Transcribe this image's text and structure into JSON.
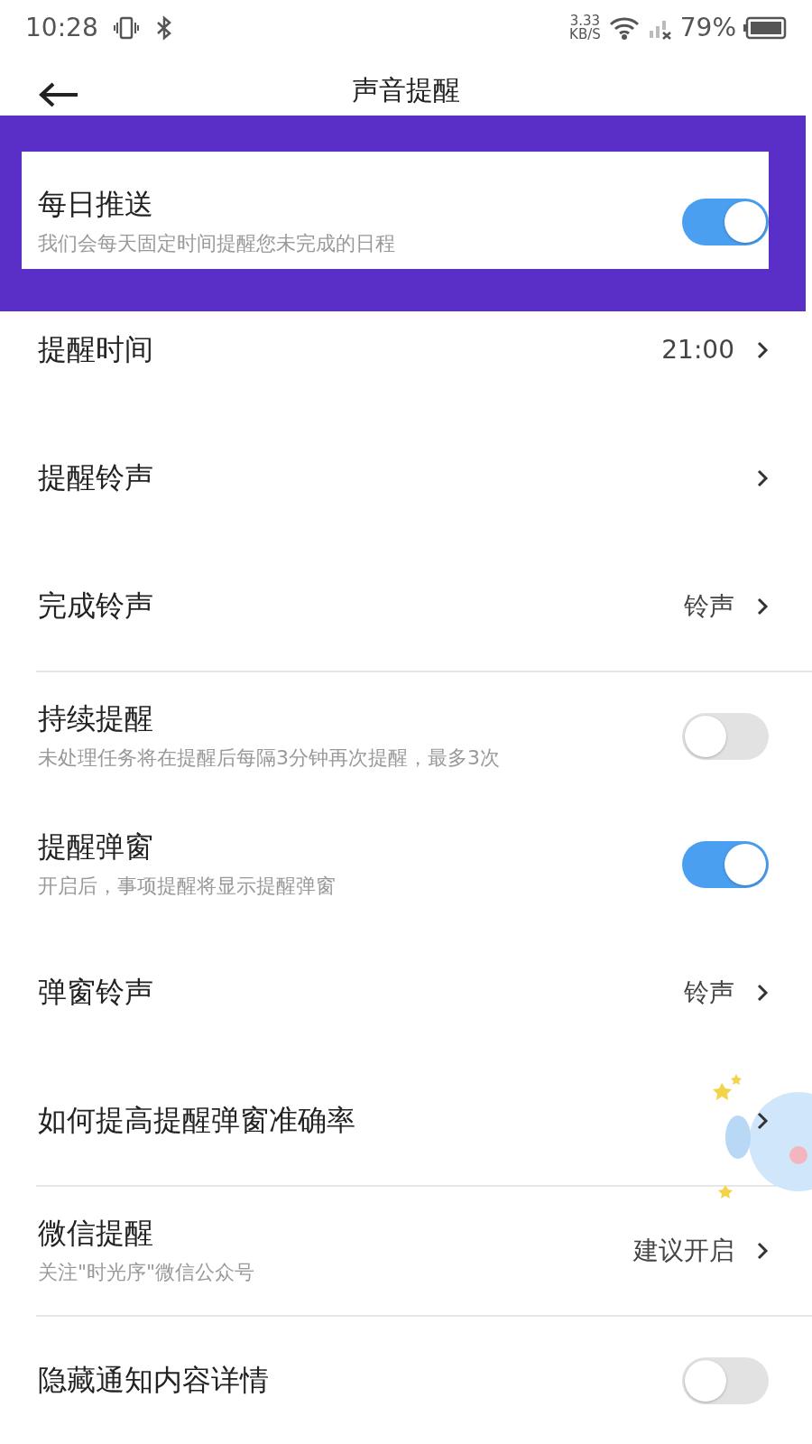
{
  "status_bar": {
    "time": "10:28",
    "speed_value": "3.33",
    "speed_unit": "KB/S",
    "battery": "79%"
  },
  "header": {
    "title": "声音提醒"
  },
  "settings": [
    {
      "kind": "toggle",
      "title": "每日推送",
      "subtitle": "我们会每天固定时间提醒您未完成的日程",
      "on": true,
      "highlighted": true
    },
    {
      "kind": "link",
      "title": "提醒时间",
      "value": "21:00"
    },
    {
      "kind": "link",
      "title": "提醒铃声"
    },
    {
      "kind": "link",
      "title": "完成铃声",
      "value": "铃声",
      "divider_after": true
    },
    {
      "kind": "toggle",
      "title": "持续提醒",
      "subtitle": "未处理任务将在提醒后每隔3分钟再次提醒，最多3次",
      "on": false
    },
    {
      "kind": "toggle",
      "title": "提醒弹窗",
      "subtitle": "开启后，事项提醒将显示提醒弹窗",
      "on": true
    },
    {
      "kind": "link",
      "title": "弹窗铃声",
      "value": "铃声"
    },
    {
      "kind": "link",
      "title": "如何提高提醒弹窗准确率",
      "divider_after": true
    },
    {
      "kind": "link",
      "title": "微信提醒",
      "subtitle": "关注\"时光序\"微信公众号",
      "value": "建议开启",
      "divider_after": true
    },
    {
      "kind": "toggle",
      "title": "隐藏通知内容详情",
      "on": false
    }
  ]
}
